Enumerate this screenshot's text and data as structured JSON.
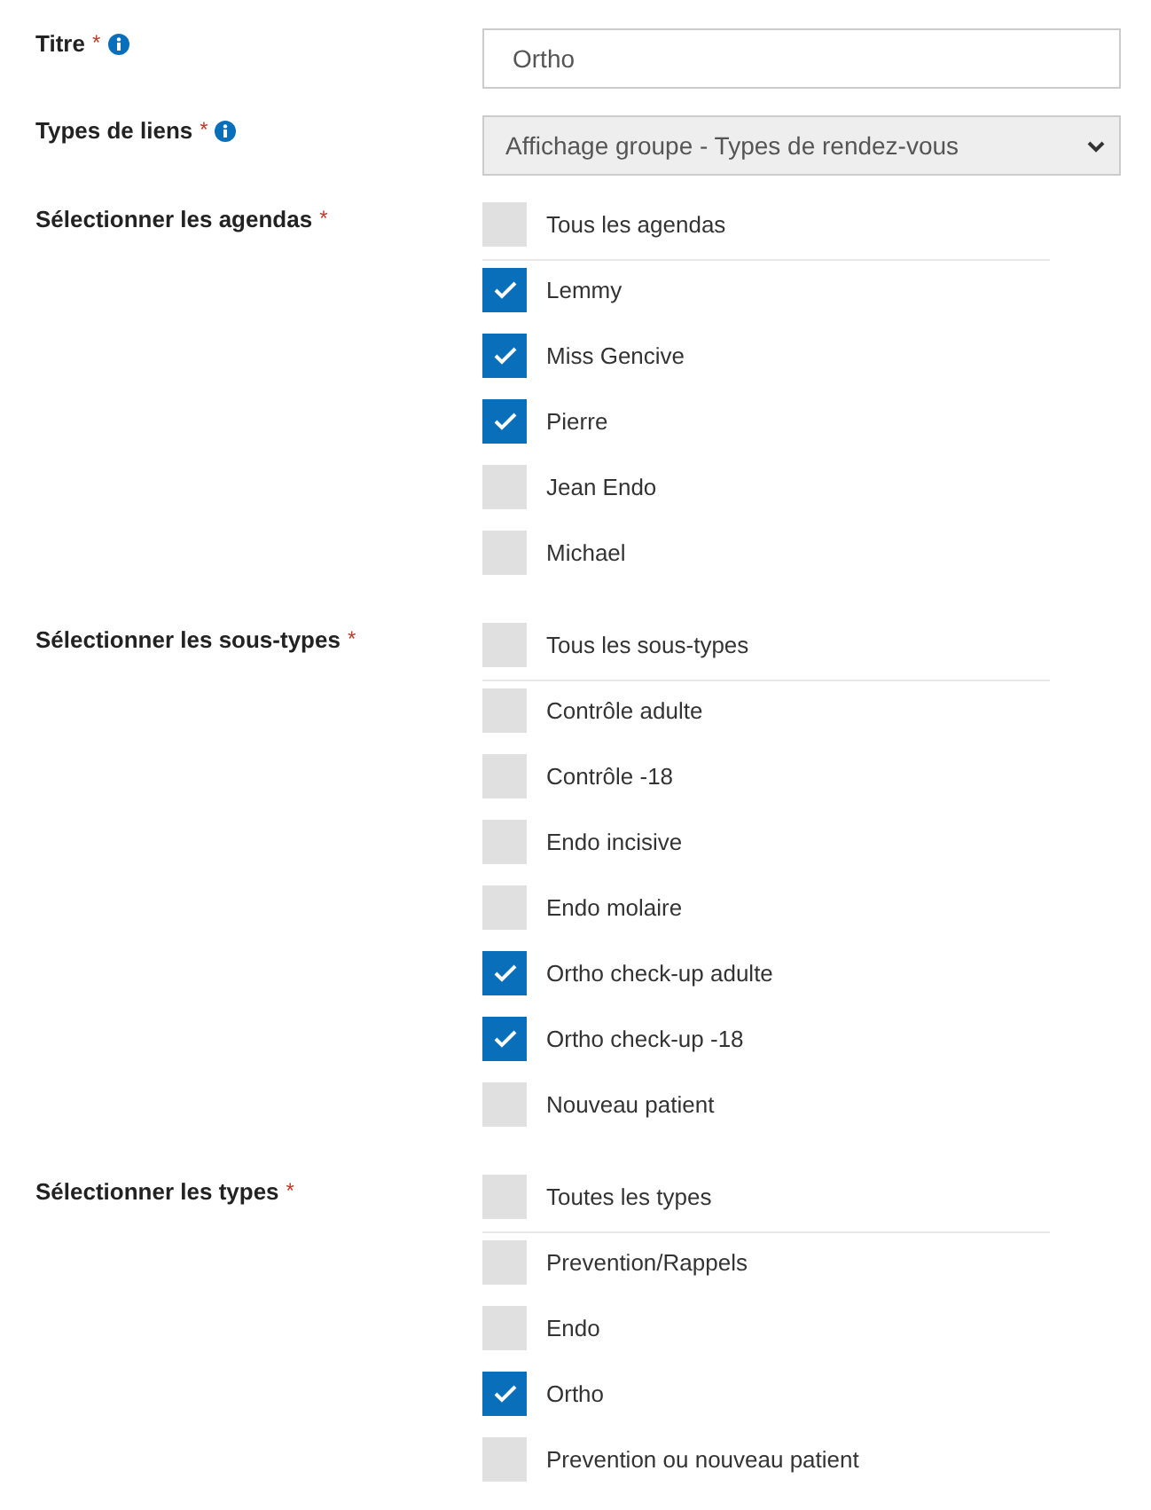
{
  "fields": [
    {
      "kind": "text",
      "label": "Titre",
      "required_mark": "*",
      "info": true,
      "value": "Ortho"
    },
    {
      "kind": "select",
      "label": "Types de liens",
      "required_mark": "*",
      "info": true,
      "value": "Affichage groupe - Types de rendez-vous"
    },
    {
      "kind": "checklist",
      "label": "Sélectionner les agendas",
      "required_mark": "*",
      "info": false,
      "all": {
        "label": "Tous les agendas",
        "checked": false
      },
      "options": [
        {
          "label": "Lemmy",
          "checked": true
        },
        {
          "label": "Miss Gencive",
          "checked": true
        },
        {
          "label": "Pierre",
          "checked": true
        },
        {
          "label": "Jean Endo",
          "checked": false
        },
        {
          "label": "Michael",
          "checked": false
        }
      ]
    },
    {
      "kind": "checklist",
      "label": "Sélectionner les sous-types",
      "required_mark": "*",
      "info": false,
      "all": {
        "label": "Tous les sous-types",
        "checked": false
      },
      "options": [
        {
          "label": "Contrôle adulte",
          "checked": false
        },
        {
          "label": "Contrôle -18",
          "checked": false
        },
        {
          "label": "Endo incisive",
          "checked": false
        },
        {
          "label": "Endo molaire",
          "checked": false
        },
        {
          "label": "Ortho check-up adulte",
          "checked": true
        },
        {
          "label": "Ortho check-up -18",
          "checked": true
        },
        {
          "label": "Nouveau patient",
          "checked": false
        }
      ]
    },
    {
      "kind": "checklist",
      "label": "Sélectionner les types",
      "required_mark": "*",
      "info": false,
      "all": {
        "label": "Toutes les types",
        "checked": false
      },
      "options": [
        {
          "label": "Prevention/Rappels",
          "checked": false
        },
        {
          "label": "Endo",
          "checked": false
        },
        {
          "label": "Ortho",
          "checked": true
        },
        {
          "label": "Prevention ou nouveau patient",
          "checked": false
        }
      ]
    }
  ]
}
